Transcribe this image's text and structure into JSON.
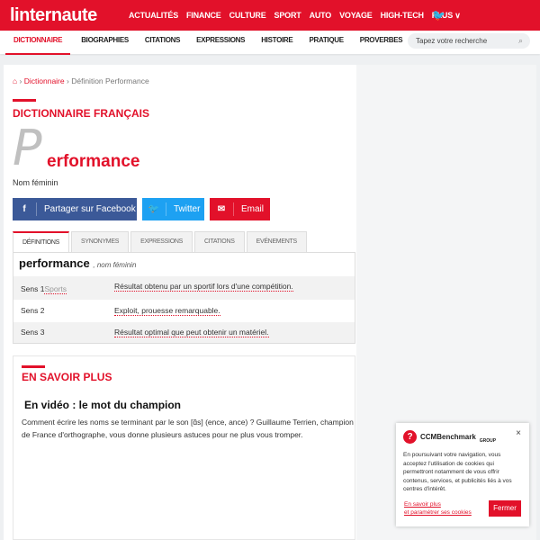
{
  "header": {
    "logo": "linternaute",
    "nav": [
      "ACTUALITÉS",
      "FINANCE",
      "CULTURE",
      "SPORT",
      "AUTO",
      "VOYAGE",
      "HIGH-TECH",
      "PLUS ∨"
    ],
    "twitter_icon": "twitter-icon"
  },
  "subnav": {
    "items": [
      "DICTIONNAIRE",
      "BIOGRAPHIES",
      "CITATIONS",
      "EXPRESSIONS",
      "HISTOIRE",
      "PRATIQUE",
      "PROVERBES"
    ],
    "search_placeholder": "Tapez votre recherche"
  },
  "breadcrumb": {
    "home": "⌂",
    "sep": "›",
    "items": [
      "Dictionnaire",
      "Définition Performance"
    ]
  },
  "section_title": "DICTIONNAIRE FRANÇAIS",
  "word": {
    "initial": "P",
    "rest": "erformance",
    "gender": "Nom féminin"
  },
  "share": {
    "facebook": "Partager sur Facebook",
    "twitter": "Twitter",
    "email": "Email",
    "colors": {
      "facebook": "#3b5998",
      "twitter": "#1da1f2",
      "email": "#e2112a"
    }
  },
  "tabs": [
    "DÉFINITIONS",
    "SYNONYMES",
    "EXPRESSIONS",
    "CITATIONS",
    "EVÉNEMENTS"
  ],
  "definitions": {
    "headword": "performance",
    "pos": ", nom féminin",
    "rows": [
      {
        "sense": "Sens 1",
        "domain": "Sports",
        "text": "Résultat obtenu par un sportif lors d'une compétition."
      },
      {
        "sense": "Sens 2",
        "domain": "",
        "text": "Exploit, prouesse remarquable."
      },
      {
        "sense": "Sens 3",
        "domain": "",
        "text": "Résultat optimal que peut obtenir un matériel."
      }
    ]
  },
  "more": {
    "title": "EN SAVOIR PLUS",
    "video_title": "En vidéo : le mot du champion",
    "video_text": "Comment écrire les noms se terminant par le son [ɑ̃s] (ence, ance) ? Guillaume Terrien, champion de France d'orthographe, vous donne plusieurs astuces pour ne plus vous tromper."
  },
  "cookie": {
    "brand": "CCMBenchmark",
    "brand_sub": "GROUP",
    "text": "En poursuivant votre navigation, vous acceptez l'utilisation de cookies qui permettront notamment de vous offrir contenus, services, et publicités liés à vos centres d'intérêt.",
    "link1": "En savoir plus",
    "link2": "et paramétrer ses cookies",
    "button": "Fermer",
    "close": "×"
  },
  "accent": "#e2112a"
}
